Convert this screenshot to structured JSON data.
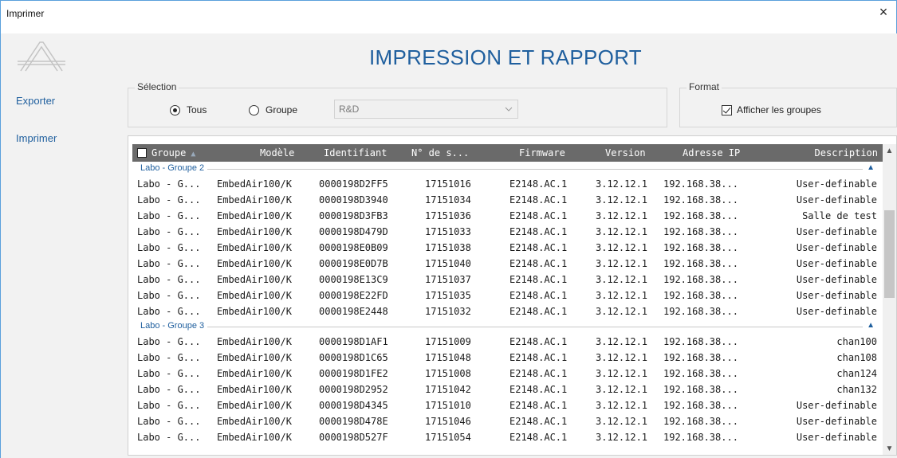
{
  "window": {
    "title": "Imprimer",
    "close_glyph": "×"
  },
  "sidebar": {
    "logo_icon": "brand-a-logo-icon",
    "items": [
      {
        "label": "Exporter"
      },
      {
        "label": "Imprimer"
      }
    ]
  },
  "main": {
    "title": "IMPRESSION ET RAPPORT"
  },
  "selection": {
    "legend": "Sélection",
    "radio_all": "Tous",
    "radio_group": "Groupe",
    "selected": "Tous",
    "combo_value": "R&D"
  },
  "format": {
    "legend": "Format",
    "show_groups_label": "Afficher les groupes",
    "show_groups_checked": true
  },
  "table": {
    "columns": [
      "Groupe",
      "Modèle",
      "Identifiant",
      "N° de s...",
      "Firmware",
      "Version",
      "Adresse IP",
      "Description"
    ],
    "groups": [
      {
        "label": "Labo - Groupe 2",
        "rows": [
          [
            "Labo - G...",
            "EmbedAir100/K",
            "0000198D2FF5",
            "17151016",
            "E2148.AC.1",
            "3.12.12.1",
            "192.168.38...",
            "User-definable"
          ],
          [
            "Labo - G...",
            "EmbedAir100/K",
            "0000198D3940",
            "17151034",
            "E2148.AC.1",
            "3.12.12.1",
            "192.168.38...",
            "User-definable"
          ],
          [
            "Labo - G...",
            "EmbedAir100/K",
            "0000198D3FB3",
            "17151036",
            "E2148.AC.1",
            "3.12.12.1",
            "192.168.38...",
            "Salle de test"
          ],
          [
            "Labo - G...",
            "EmbedAir100/K",
            "0000198D479D",
            "17151033",
            "E2148.AC.1",
            "3.12.12.1",
            "192.168.38...",
            "User-definable"
          ],
          [
            "Labo - G...",
            "EmbedAir100/K",
            "0000198E0B09",
            "17151038",
            "E2148.AC.1",
            "3.12.12.1",
            "192.168.38...",
            "User-definable"
          ],
          [
            "Labo - G...",
            "EmbedAir100/K",
            "0000198E0D7B",
            "17151040",
            "E2148.AC.1",
            "3.12.12.1",
            "192.168.38...",
            "User-definable"
          ],
          [
            "Labo - G...",
            "EmbedAir100/K",
            "0000198E13C9",
            "17151037",
            "E2148.AC.1",
            "3.12.12.1",
            "192.168.38...",
            "User-definable"
          ],
          [
            "Labo - G...",
            "EmbedAir100/K",
            "0000198E22FD",
            "17151035",
            "E2148.AC.1",
            "3.12.12.1",
            "192.168.38...",
            "User-definable"
          ],
          [
            "Labo - G...",
            "EmbedAir100/K",
            "0000198E2448",
            "17151032",
            "E2148.AC.1",
            "3.12.12.1",
            "192.168.38...",
            "User-definable"
          ]
        ]
      },
      {
        "label": "Labo - Groupe 3",
        "rows": [
          [
            "Labo - G...",
            "EmbedAir100/K",
            "0000198D1AF1",
            "17151009",
            "E2148.AC.1",
            "3.12.12.1",
            "192.168.38...",
            "chan100"
          ],
          [
            "Labo - G...",
            "EmbedAir100/K",
            "0000198D1C65",
            "17151048",
            "E2148.AC.1",
            "3.12.12.1",
            "192.168.38...",
            "chan108"
          ],
          [
            "Labo - G...",
            "EmbedAir100/K",
            "0000198D1FE2",
            "17151008",
            "E2148.AC.1",
            "3.12.12.1",
            "192.168.38...",
            "chan124"
          ],
          [
            "Labo - G...",
            "EmbedAir100/K",
            "0000198D2952",
            "17151042",
            "E2148.AC.1",
            "3.12.12.1",
            "192.168.38...",
            "chan132"
          ],
          [
            "Labo - G...",
            "EmbedAir100/K",
            "0000198D4345",
            "17151010",
            "E2148.AC.1",
            "3.12.12.1",
            "192.168.38...",
            "User-definable"
          ],
          [
            "Labo - G...",
            "EmbedAir100/K",
            "0000198D478E",
            "17151046",
            "E2148.AC.1",
            "3.12.12.1",
            "192.168.38...",
            "User-definable"
          ],
          [
            "Labo - G...",
            "EmbedAir100/K",
            "0000198D527F",
            "17151054",
            "E2148.AC.1",
            "3.12.12.1",
            "192.168.38...",
            "User-definable"
          ]
        ]
      }
    ]
  },
  "colors": {
    "accent": "#1f5f9e",
    "header_bg": "#6a6a6a",
    "panel_bg": "#f2f2f2"
  }
}
